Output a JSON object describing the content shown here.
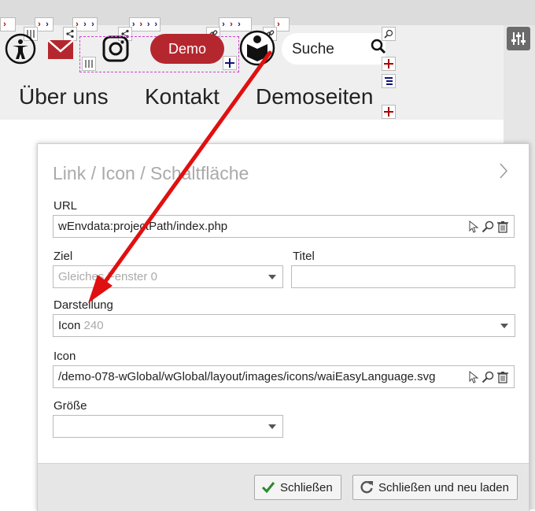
{
  "header": {
    "demo_button": "Demo",
    "search_label": "Suche",
    "nav": [
      "Über uns",
      "Kontakt",
      "Demoseiten"
    ]
  },
  "dialog": {
    "title": "Link / Icon / Schaltfläche",
    "url_label": "URL",
    "url_value": "wEnvdata:projectPath/index.php",
    "target_label": "Ziel",
    "target_value": "Gleiches Fenster",
    "target_code": "0",
    "title_label": "Titel",
    "title_value": "",
    "display_label": "Darstellung",
    "display_value": "Icon",
    "display_code": "240",
    "icon_label": "Icon",
    "icon_value": "/demo-078-wGlobal/wGlobal/layout/images/icons/waiEasyLanguage.svg",
    "size_label": "Größe",
    "size_value": "",
    "close_button": "Schließen",
    "close_reload_button": "Schließen und neu laden"
  },
  "colors": {
    "brand": "#b5272e",
    "arrow": "#e01010",
    "toolbar_red": "#aa0000",
    "toolbar_blue": "#111177"
  }
}
